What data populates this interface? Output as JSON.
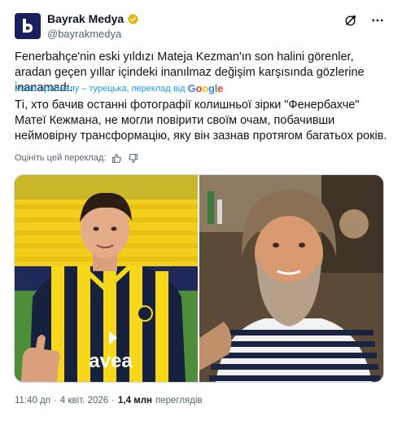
{
  "account": {
    "name": "Bayrak Medya",
    "handle": "@bayrakmedya",
    "avatar_letter": "b",
    "verified_color": "#e2b719",
    "avatar_color": "#1a1f5e"
  },
  "tweet": {
    "original_text": "Fenerbahçe'nin eski yıldızı Mateja Kezman'ın son halini görenler, aradan geçen yıllar içindeki inanılmaz değişim karşısında gözlerine inanamadı.",
    "translation_meta": "Мова оригіналу – турецька, переклад від",
    "translation_provider": [
      "G",
      "o",
      "o",
      "g",
      "l",
      "e"
    ],
    "translated_text": "Ті, хто бачив останні фотографії колишньої зірки \"Фенербахче\" Матеї Кежмана, не могли повірити своїм очам, побачивши неймовірну трансформацію, яку він зазнав протягом багатьох років.",
    "rate_label": "Оцініть цей переклад:"
  },
  "media": {
    "left_jersey_text": "avea"
  },
  "meta": {
    "time": "11:40 дп",
    "separator": "·",
    "date": "4 квіт. 2026",
    "views_count": "1,4 млн",
    "views_label": "переглядів"
  },
  "icons": {
    "grok": "grok-icon",
    "more": "more-icon",
    "thumb_up": "thumb-up-icon",
    "thumb_down": "thumb-down-icon",
    "verified": "verified-badge-icon"
  },
  "colors": {
    "link": "#1d9bf0",
    "secondary": "#536471",
    "jersey_yellow": "#f6d71a",
    "jersey_navy": "#16213e"
  }
}
